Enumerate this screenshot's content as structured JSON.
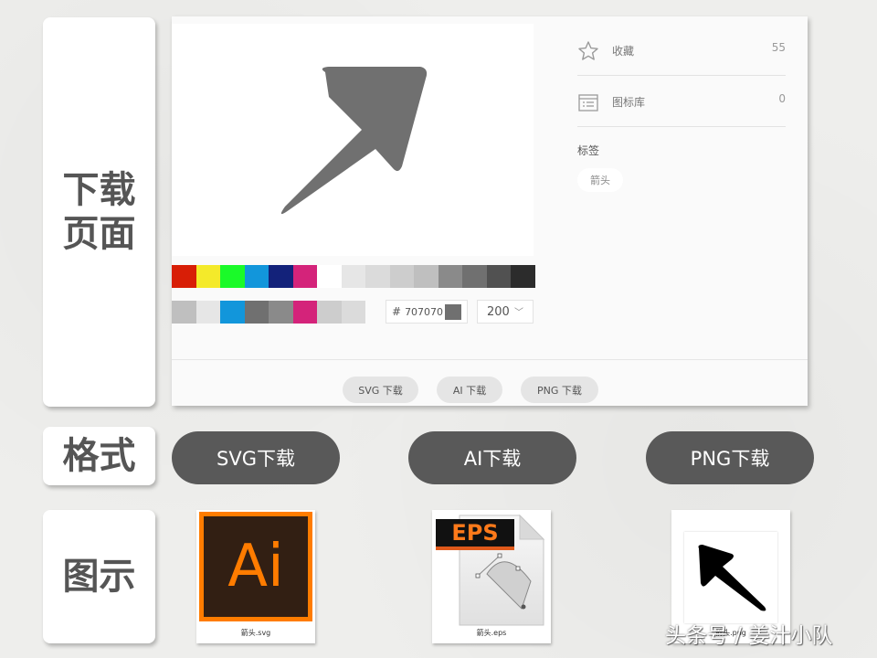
{
  "row_labels": {
    "download_page_line1": "下载",
    "download_page_line2": "页面",
    "format": "格式",
    "illustration": "图示"
  },
  "preview": {
    "icon": "arrow-up-right-icon",
    "icon_color": "#707070"
  },
  "palette": {
    "row1": [
      "#d81e06",
      "#f4ea2a",
      "#1afa29",
      "#1296db",
      "#13227a",
      "#d4237a",
      "#ffffff",
      "#e6e6e6",
      "#dbdbdb",
      "#cdcdcd",
      "#bfbfbf",
      "#8a8a8a",
      "#707070",
      "#515151",
      "#2c2c2c"
    ],
    "row2": [
      "#bfbfbf",
      "#e6e6e6",
      "#1296db",
      "#707070",
      "#8a8a8a",
      "#d4237a",
      "#cdcdcd",
      "#dbdbdb"
    ]
  },
  "color_input": {
    "hash": "#",
    "value": "707070",
    "swatch": "#707070"
  },
  "size_select": {
    "value": "200"
  },
  "info": {
    "favorites_label": "收藏",
    "favorites_count": "55",
    "library_label": "图标库",
    "library_count": "0",
    "tags_title": "标签",
    "tag": "箭头"
  },
  "download_buttons": {
    "svg": "SVG 下载",
    "ai": "AI 下载",
    "png": "PNG 下载"
  },
  "format_buttons": {
    "svg": "SVG下载",
    "ai": "AI下载",
    "png": "PNG下载"
  },
  "files": {
    "ai_logo": "Ai",
    "ai_name": "箭头.svg",
    "eps_badge": "EPS",
    "eps_name": "箭头.eps",
    "png_name": "箭头.png",
    "png_icon": "arrow-up-left-icon"
  },
  "watermark": "头条号 / 姜汁小队"
}
